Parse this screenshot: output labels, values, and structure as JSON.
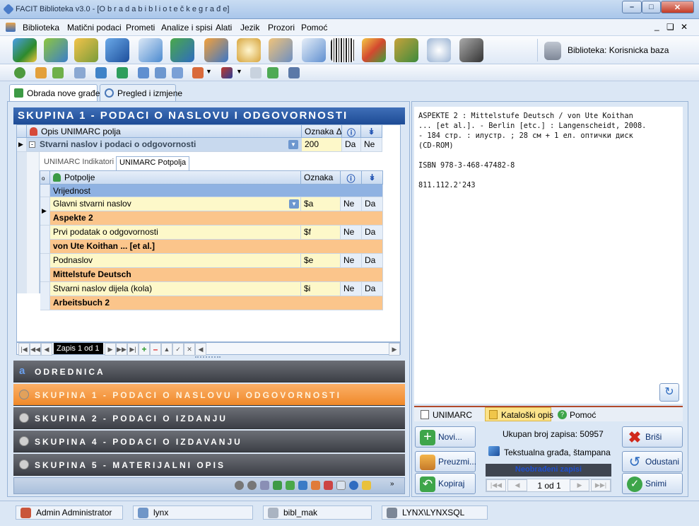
{
  "window": {
    "title": "FACIT Biblioteka v3.0 - [O b r a d a   b i b l i o t e č k e   g r a đ e]"
  },
  "menu": [
    "Biblioteka",
    "Matični podaci",
    "Prometi",
    "Analize i spisi",
    "Alati",
    "Jezik",
    "Prozori",
    "Pomoć"
  ],
  "toolbar": {
    "library_label": "Biblioteka: Korisnicka baza"
  },
  "tabs": {
    "new_entry": "Obrada nove građe",
    "review": "Pregled i izmjene"
  },
  "left": {
    "header": "SKUPINA 1 - PODACI O NASLOVU I ODGOVORNOSTI",
    "grid": {
      "col_desc": "Opis UNIMARC polja",
      "col_code": "Oznaka",
      "row_desc": "Stvarni naslov i podaci o odgovornosti",
      "row_code": "200",
      "row_v1": "Da",
      "row_v2": "Ne"
    },
    "subtabs": {
      "indicators": "UNIMARC Indikatori",
      "subfields": "UNIMARC Potpolja"
    },
    "subgrid": {
      "col_subfield": "Potpolje",
      "col_code": "Oznaka",
      "value_header": "Vrijednost",
      "rows": [
        {
          "name": "Glavni stvarni naslov",
          "code": "$a",
          "v1": "Ne",
          "v2": "Da",
          "value": "Aspekte 2"
        },
        {
          "name": "Prvi podatak o odgovornosti",
          "code": "$f",
          "v1": "Ne",
          "v2": "Da",
          "value": "von Ute Koithan ... [et al.]"
        },
        {
          "name": "Podnaslov",
          "code": "$e",
          "v1": "Ne",
          "v2": "Da",
          "value": "Mittelstufe Deutsch"
        },
        {
          "name": "Stvarni naslov dijela (kola)",
          "code": "$i",
          "v1": "Ne",
          "v2": "Da",
          "value": "Arbeitsbuch 2"
        }
      ]
    },
    "navigator": "Zapis 1 od 1",
    "sections": [
      {
        "label": "ODREDNICA"
      },
      {
        "label": "SKUPINA 1 - PODACI O NASLOVU I ODGOVORNOSTI"
      },
      {
        "label": "SKUPINA 2 - PODACI O IZDANJU"
      },
      {
        "label": "SKUPINA 4 - PODACI O IZDAVANJU"
      },
      {
        "label": "SKUPINA 5 - MATERIJALNI OPIS"
      }
    ]
  },
  "right": {
    "catalog_lines": [
      "ASPEKTE 2 : Mittelstufe Deutsch / von Ute Koithan",
      "... [et al.]. - Berlin [etc.] : Langenscheidt, 2008.",
      "- 184 стр. : илустр. ; 28 см + 1 ел. оптички диск",
      "(CD-ROM)",
      "",
      "ISBN 978-3-468-47482-8",
      "",
      "811.112.2'243"
    ],
    "bottom_tabs": {
      "unimarc": "UNIMARC",
      "catalog": "Kataloški opis",
      "help": "Pomoć"
    },
    "total_records": "Ukupan broj zapisa: 50957",
    "material_type": "Tekstualna građa, štampana",
    "unprocessed": "Neobrađeni zapisi",
    "pager": "1 od 1",
    "buttons": {
      "new": "Novi...",
      "import": "Preuzmi...",
      "copy": "Kopiraj",
      "delete": "Briši",
      "cancel": "Odustani",
      "save": "Snimi"
    }
  },
  "status": {
    "user": "Admin Administrator",
    "server": "lynx",
    "db": "bibl_mak",
    "connection": "LYNX\\LYNXSQL"
  }
}
